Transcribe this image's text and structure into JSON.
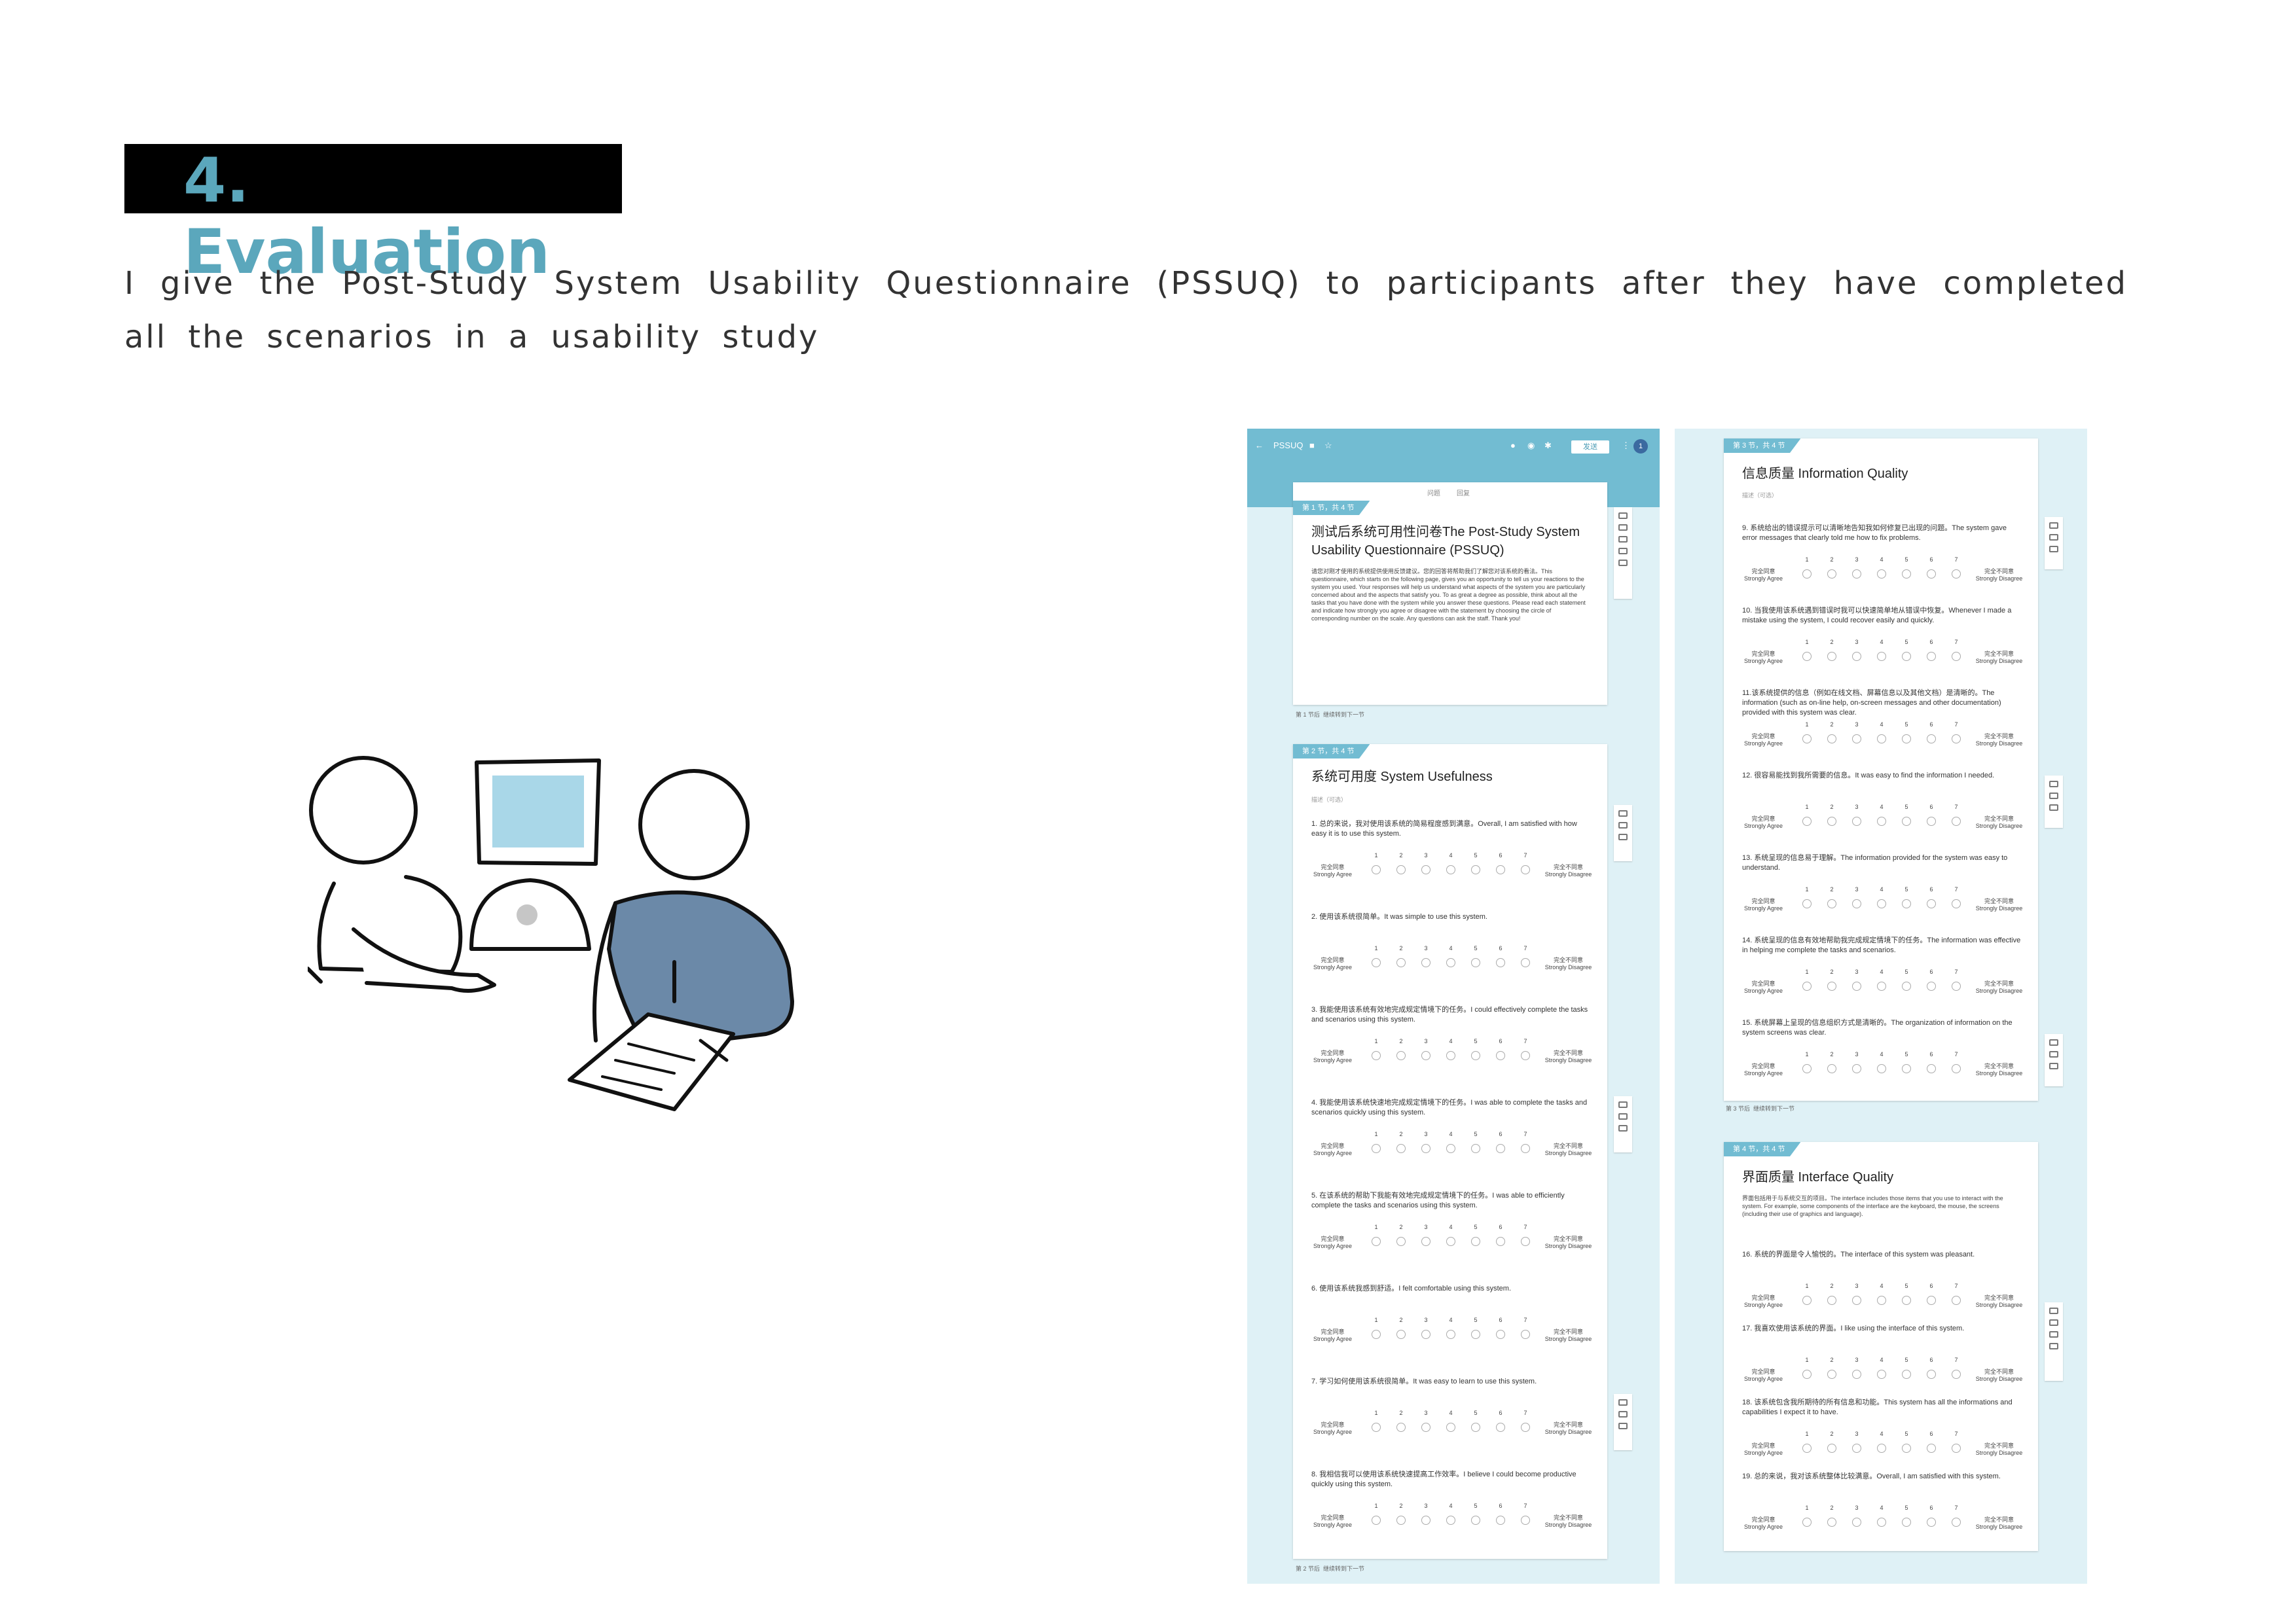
{
  "heading": "4. Evaluation",
  "intro": "I give the Post-Study System Usability Questionnaire (PSSUQ) to participants after they have completed all the scenarios in a usability study",
  "form": {
    "app_title": "PSSUQ",
    "send_label": "发送",
    "avatar": "1",
    "tabs": [
      "问题",
      "回复"
    ],
    "scale_numbers": [
      "1",
      "2",
      "3",
      "4",
      "5",
      "6",
      "7"
    ],
    "scale_left": "完全同意 Strongly Agree",
    "scale_right": "完全不同意 Strongly Disagree",
    "required_mark": "*",
    "next_label": "继续转到下一节"
  },
  "sections": [
    {
      "tag": "第 1 节，共 4 节",
      "title": "测试后系统可用性问卷The Post-Study System Usability Questionnaire (PSSUQ)",
      "desc": "请您对刚才使用的系统提供使用反馈建议。您的回答将帮助我们了解您对该系统的看法。This questionnaire, which starts on the following page, gives you an opportunity to tell us your reactions to the system you used. Your responses will help us understand what aspects of the system you are particularly concerned about and the aspects that satisfy you. To as great a degree as possible, think about all the tasks that you have done with the system while you answer these questions. Please read each statement and indicate how strongly you agree or disagree with the statement by choosing the circle of corresponding number on the scale. Any questions can ask the staff. Thank you!",
      "footer": "第 1 节后"
    },
    {
      "tag": "第 2 节，共 4 节",
      "title": "系统可用度 System Usefulness",
      "note": "描述（可选）",
      "footer": "第 2 节后",
      "questions": [
        "1. 总的来说，我对使用该系统的简易程度感到满意。Overall, I am satisfied with how easy it is to use this system.",
        "2. 使用该系统很简单。It was simple to use this system.",
        "3. 我能使用该系统有效地完成规定情境下的任务。I could effectively complete the tasks and scenarios using this system.",
        "4. 我能使用该系统快速地完成规定情境下的任务。I was able to complete the tasks and scenarios quickly using this system.",
        "5. 在该系统的帮助下我能有效地完成规定情境下的任务。I was able to efficiently complete the tasks and scenarios using this system.",
        "6. 使用该系统我感到舒适。I felt comfortable using this system.",
        "7. 学习如何使用该系统很简单。It was easy to learn to use this system.",
        "8. 我相信我可以使用该系统快速提高工作效率。I believe I could become productive quickly using this system."
      ]
    },
    {
      "tag": "第 3 节，共 4 节",
      "title": "信息质量 Information Quality",
      "note": "描述（可选）",
      "footer": "第 3 节后",
      "questions": [
        "9. 系统给出的错误提示可以清晰地告知我如何修复已出现的问题。The system gave error messages that clearly told me how to fix problems.",
        "10. 当我使用该系统遇到错误时我可以快速简单地从错误中恢复。Whenever I made a mistake using the system, I could recover easily and quickly.",
        "11.该系统提供的信息（例如在线文档、屏幕信息以及其他文档）是清晰的。The information (such as on-line help, on-screen messages and other documentation) provided with this system was clear.",
        "12. 很容易能找到我所需要的信息。It was easy to find the information I needed.",
        "13. 系统呈现的信息易于理解。The information provided for the system was easy to understand.",
        "14. 系统呈现的信息有效地帮助我完成规定情境下的任务。The information was effective in helping me complete the tasks and scenarios.",
        "15. 系统屏幕上呈现的信息组织方式是清晰的。The organization of information on the system screens was clear."
      ]
    },
    {
      "tag": "第 4 节，共 4 节",
      "title": "界面质量 Interface Quality",
      "desc": "界面包括用于与系统交互的项目。The interface includes those items that you use to interact with the system. For example, some components of the interface are the keyboard, the mouse, the screens (including their use of graphics and language).",
      "questions": [
        "16. 系统的界面是令人愉悦的。The interface of this system was pleasant.",
        "17. 我喜欢使用该系统的界面。I like using the interface of this system.",
        "18. 该系统包含我所期待的所有信息和功能。This system has all the informations and capabilities I expect it to have.",
        "19. 总的来说，我对该系统整体比较满意。Overall, I am satisfied with this system."
      ]
    }
  ]
}
